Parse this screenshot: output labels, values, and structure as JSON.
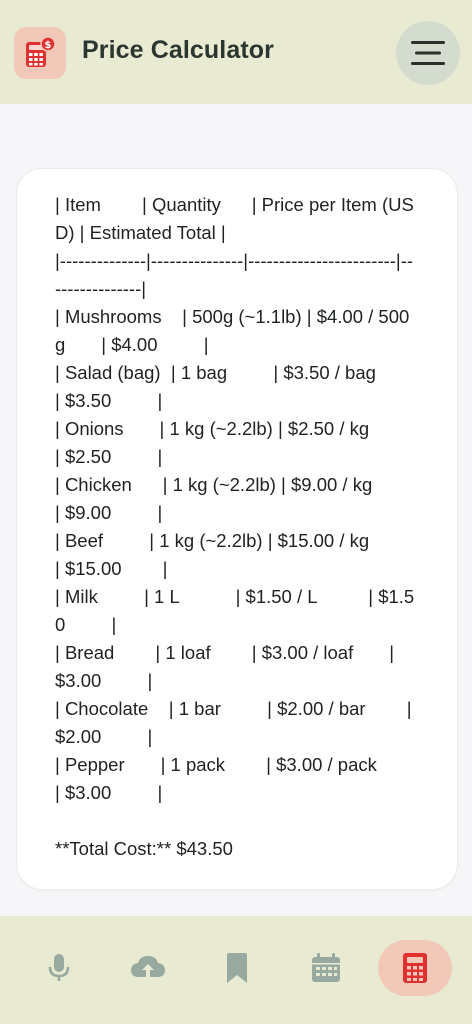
{
  "header": {
    "title": "Price Calculator",
    "app_icon": "calculator-dollar-icon",
    "menu_icon": "hamburger-menu-icon"
  },
  "card": {
    "lines": [
      "| Item        | Quantity      | Price per Item (USD) | Estimated Total |",
      "|--------------|---------------|------------------------|----------------|",
      "| Mushrooms    | 500g (~1.1lb) | $4.00 / 500g       | $4.00         |",
      "| Salad (bag)  | 1 bag         | $3.50 / bag        | $3.50         |",
      "| Onions       | 1 kg (~2.2lb) | $2.50 / kg         | $2.50         |",
      "| Chicken      | 1 kg (~2.2lb) | $9.00 / kg         | $9.00         |",
      "| Beef         | 1 kg (~2.2lb) | $15.00 / kg        | $15.00        |",
      "| Milk         | 1 L           | $1.50 / L          | $1.50         |",
      "| Bread        | 1 loaf        | $3.00 / loaf       | $3.00         |",
      "| Chocolate    | 1 bar         | $2.00 / bar        | $2.00         |",
      "| Pepper       | 1 pack        | $3.00 / pack       | $3.00         |",
      "",
      "**Total Cost:** $43.50"
    ]
  },
  "nav": {
    "items": [
      {
        "icon": "microphone-icon",
        "active": false
      },
      {
        "icon": "cloud-upload-icon",
        "active": false
      },
      {
        "icon": "bookmark-icon",
        "active": false
      },
      {
        "icon": "calendar-icon",
        "active": false
      },
      {
        "icon": "calculator-icon",
        "active": true
      }
    ]
  },
  "colors": {
    "header_bg": "#e9ead2",
    "accent": "#e0302f",
    "accent_bg": "#f2c9b9",
    "nav_icon": "#98aaa0",
    "text": "#1e2320"
  }
}
